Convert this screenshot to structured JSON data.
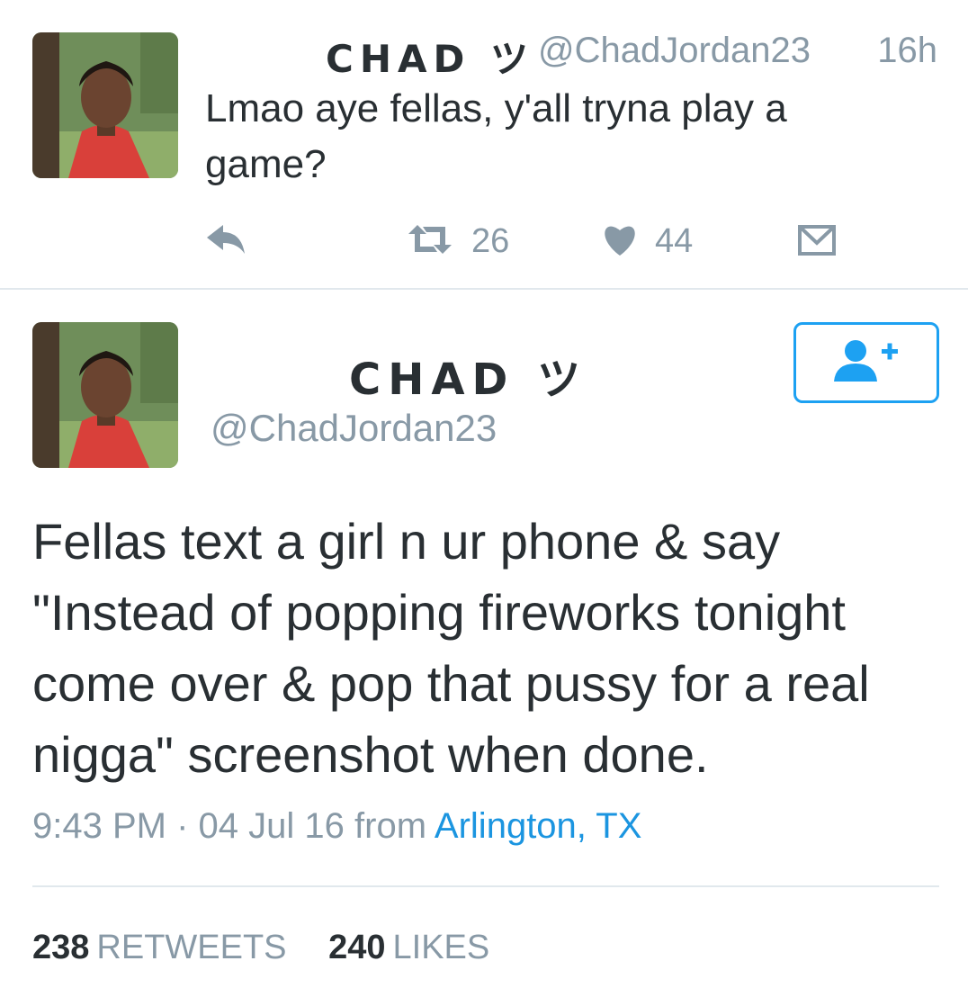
{
  "tweet1": {
    "name": "CHAD ツ",
    "handle": "@ChadJordan23",
    "time": "16h",
    "text": "Lmao aye fellas, y'all tryna play a game?",
    "retweets": "26",
    "likes": "44",
    "icons": [
      "reply-icon",
      "retweet-icon",
      "heart-icon",
      "dm-icon"
    ]
  },
  "tweet2": {
    "name": "CHAD ツ",
    "handle": "@ChadJordan23",
    "follow_icon": "add-user-icon",
    "text_lines": [
      "Fellas text a girl n ur phone & say",
      "\"Instead of popping fireworks tonight",
      "come over & pop that pussy for a real",
      "nigga\" screenshot when done."
    ],
    "time": "9:43 PM",
    "sep": "·",
    "date": "04 Jul 16",
    "from": "from",
    "location": "Arlington, TX",
    "retweet_count": "238",
    "retweet_label": "RETWEETS",
    "like_count": "240",
    "like_label": "LIKES"
  },
  "colors": {
    "text": "#292f33",
    "muted": "#8899a6",
    "link": "#1b95e0",
    "accent": "#1da1f2",
    "divider": "#e1e8ed"
  }
}
